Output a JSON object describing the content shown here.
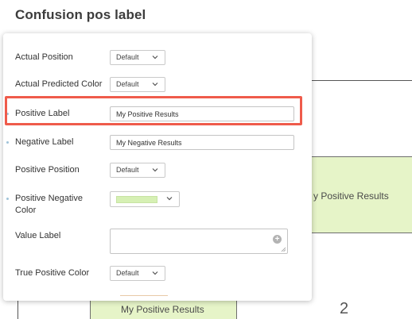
{
  "page": {
    "title": "Confusion pos label"
  },
  "matrix": {
    "cell_top_right_label": "y Positive Results",
    "cell_bottom_left_label": "My Positive Results",
    "cell_bottom_right_value": "2",
    "positive_color": "#e6f4c8"
  },
  "settings": {
    "actual_position": {
      "label": "Actual Position",
      "value": "Default"
    },
    "actual_predicted_color": {
      "label": "Actual Predicted Color",
      "value": "Default"
    },
    "positive_label": {
      "label": "Positive Label",
      "value": "My Positive Results"
    },
    "negative_label": {
      "label": "Negative Label",
      "value": "My Negative Results"
    },
    "positive_position": {
      "label": "Positive Position",
      "value": "Default"
    },
    "positive_negative_color": {
      "label": "Positive Negative Color",
      "swatch_color": "#d6f0b4"
    },
    "value_label": {
      "label": "Value Label",
      "value": ""
    },
    "true_positive_color": {
      "label": "True Positive Color",
      "value": "Default"
    }
  },
  "highlight_color": "#ef5b4b",
  "icons": {
    "select_toggle": "chevron-down-icon",
    "add": "plus-circle-icon",
    "resize": "resize-grip-icon"
  }
}
